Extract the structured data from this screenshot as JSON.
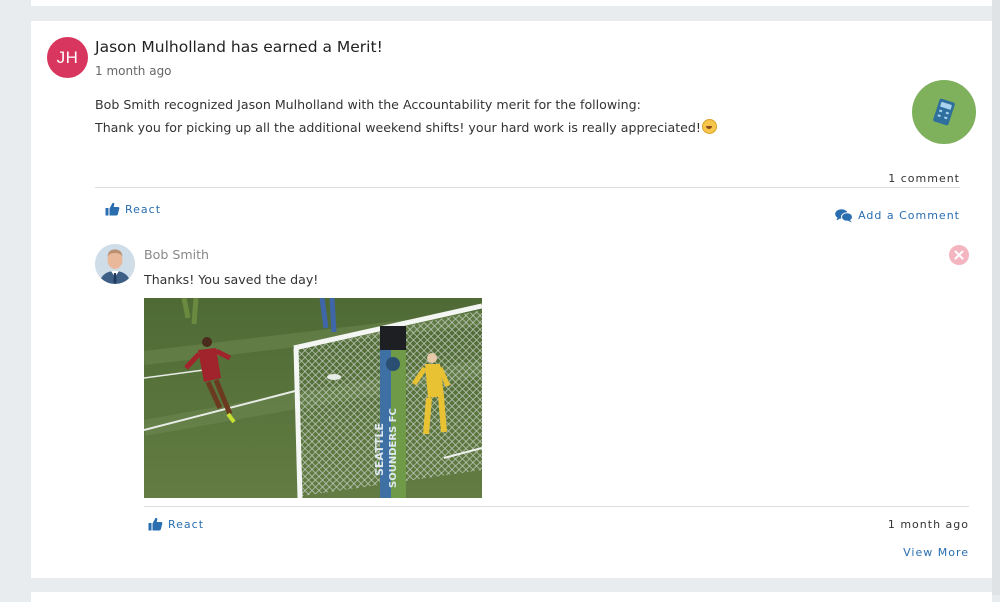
{
  "post": {
    "author_initials": "JH",
    "title": "Jason Mulholland has earned a Merit!",
    "time": "1 month ago",
    "body_line1": "Bob Smith recognized Jason Mulholland with the Accountability merit for the following:",
    "body_line2": "Thank you for picking up all the additional weekend shifts! your hard work is really appreciated!",
    "badge_icon": "calculator-icon",
    "comment_count": "1 comment",
    "react_label": "React",
    "add_comment_label": "Add a Comment"
  },
  "comment": {
    "author": "Bob Smith",
    "text": "Thanks! You saved the day!",
    "react_label": "React",
    "time": "1 month ago",
    "view_more_label": "View More",
    "gif_sign_line1": "SEATTLE",
    "gif_sign_line2": "SOUNDERS FC"
  },
  "colors": {
    "avatar_bg": "#d8365e",
    "link_blue": "#2a6eb0",
    "badge_green": "#7fb05b",
    "badge_icon_blue": "#2f6f9e",
    "delete_pink": "#f3b5bf"
  }
}
